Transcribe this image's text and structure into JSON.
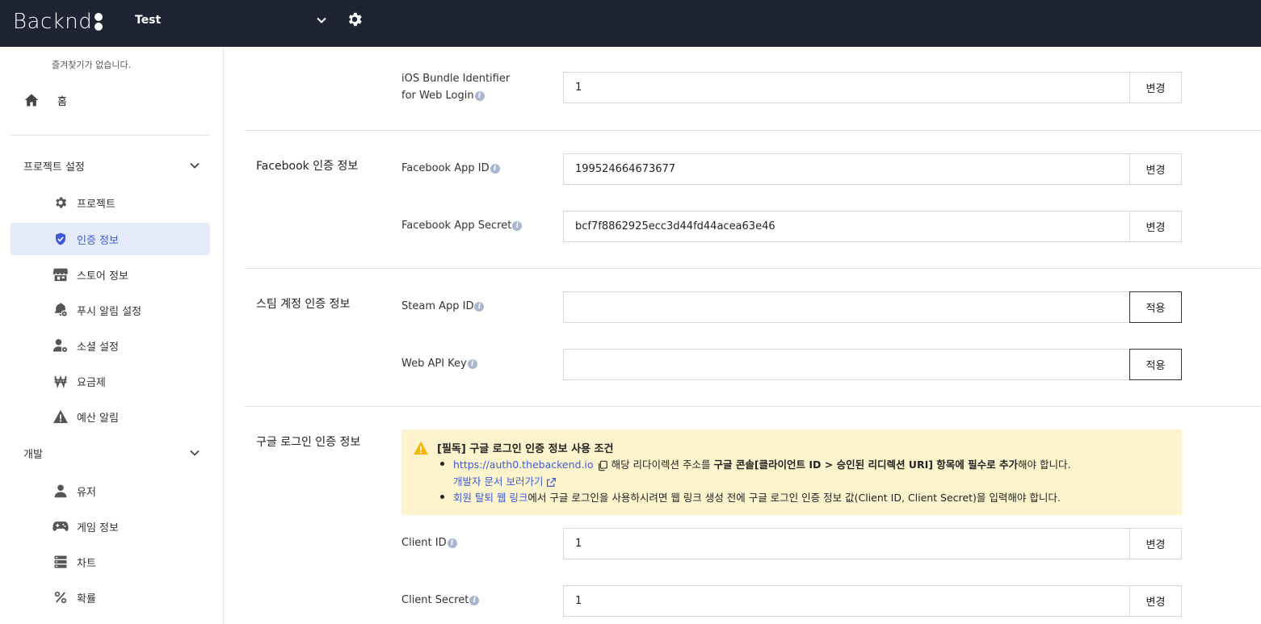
{
  "topbar": {
    "logo": "Backnd",
    "project_name": "Test"
  },
  "sidebar": {
    "favorites_empty": "즐겨찾기가 없습니다.",
    "home_label": "홈",
    "groups": [
      {
        "label": "프로젝트 설정"
      },
      {
        "label": "개발"
      }
    ],
    "project_items": [
      {
        "label": "프로젝트",
        "icon": "gear-icon"
      },
      {
        "label": "인증 정보",
        "icon": "shield-check-icon",
        "active": true
      },
      {
        "label": "스토어 정보",
        "icon": "store-icon"
      },
      {
        "label": "푸시 알림 설정",
        "icon": "bell-gear-icon"
      },
      {
        "label": "소셜 설정",
        "icon": "user-gear-icon"
      },
      {
        "label": "요금제",
        "icon": "won-icon"
      },
      {
        "label": "예산 알림",
        "icon": "warning-icon"
      }
    ],
    "dev_items": [
      {
        "label": "유저",
        "icon": "user-icon"
      },
      {
        "label": "게임 정보",
        "icon": "gamepad-icon"
      },
      {
        "label": "차트",
        "icon": "server-icon"
      },
      {
        "label": "확률",
        "icon": "percent-icon"
      }
    ]
  },
  "main": {
    "ios_section": {
      "label_line1": "iOS Bundle Identifier",
      "label_line2": "for Web Login",
      "value": "1",
      "button": "변경"
    },
    "facebook": {
      "title": "Facebook 인증 정보",
      "app_id_label": "Facebook App ID",
      "app_id_value": "199524664673677",
      "app_secret_label": "Facebook App Secret",
      "app_secret_value": "bcf7f8862925ecc3d44fd44acea63e46",
      "button": "변경"
    },
    "steam": {
      "title": "스팀 계정 인증 정보",
      "app_id_label": "Steam App ID",
      "app_id_value": "",
      "web_api_label": "Web API Key",
      "web_api_value": "",
      "button": "적용"
    },
    "google": {
      "title": "구글 로그인 인증 정보",
      "notice_title": "[필독] 구글 로그인 인증 정보 사용 조건",
      "notice_link": "https://auth0.thebackend.io",
      "notice_text1a": "해당 리다이렉션 주소를 ",
      "notice_text1b": "구글 콘솔[클라이언트 ID > 승인된 리디렉션 URI] 항목에 필수로 추가",
      "notice_text1c": "해야 합니다.",
      "notice_doc_link": "개발자 문서 보러가기",
      "notice_link2": "회원 탈퇴 웹 링크",
      "notice_text2": "에서 구글 로그인을 사용하시려면 웹 링크 생성 전에 구글 로그인 인증 정보 값(Client ID, Client Secret)을 입력해야 합니다.",
      "client_id_label": "Client ID",
      "client_id_value": "1",
      "client_secret_label": "Client Secret",
      "client_secret_value": "1",
      "button": "변경"
    }
  }
}
